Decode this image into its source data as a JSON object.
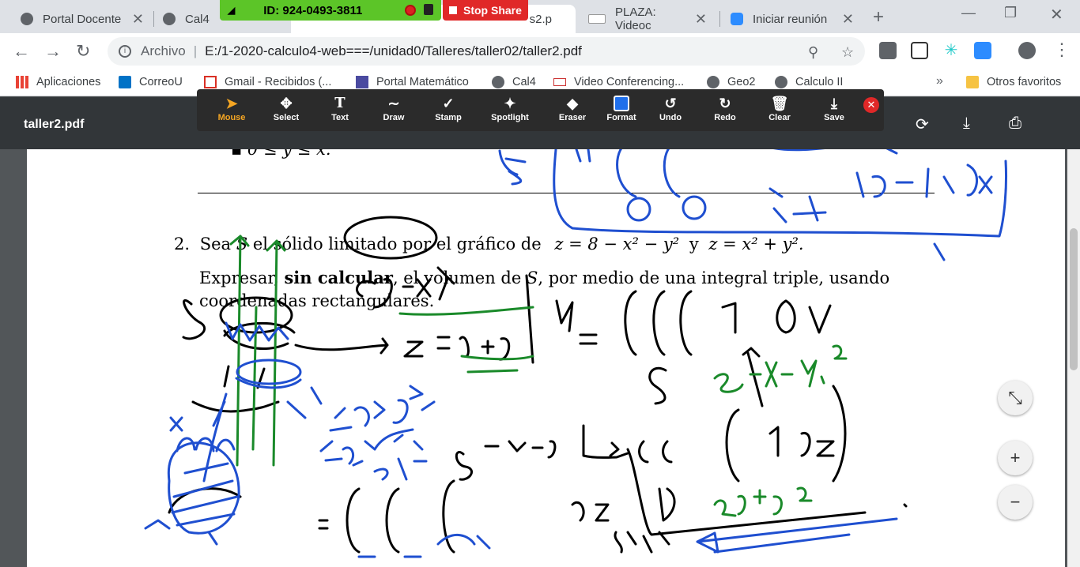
{
  "tabs": [
    {
      "label": "Portal Docente",
      "active": false
    },
    {
      "label": "Cal4",
      "active": false
    },
    {
      "label": "s2.p",
      "active": true
    },
    {
      "label": "PLAZA: Videoc",
      "active": false
    },
    {
      "label": "Iniciar reunión",
      "active": false
    }
  ],
  "zoom": {
    "meeting_id": "ID: 924-0493-3811",
    "stop_share_label": "Stop Share"
  },
  "address": {
    "scheme_label": "Archivo",
    "url": "E:/1-2020-calculo4-web===/unidad0/Talleres/taller02/taller2.pdf"
  },
  "bookmarks": [
    {
      "label": "Aplicaciones",
      "icon": "apps-grid-icon"
    },
    {
      "label": "CorreoU",
      "icon": "outlook-icon"
    },
    {
      "label": "Gmail - Recibidos (...",
      "icon": "gmail-icon"
    },
    {
      "label": "Portal Matemático",
      "icon": "pattern-icon"
    },
    {
      "label": "Cal4",
      "icon": "globe-icon"
    },
    {
      "label": "Video Conferencing...",
      "icon": "flag-icon"
    },
    {
      "label": "Geo2",
      "icon": "globe-icon"
    },
    {
      "label": "Calculo II",
      "icon": "globe-icon"
    }
  ],
  "other_bookmarks": "Otros favoritos",
  "pdf": {
    "title": "taller2.pdf",
    "header_fragment": "0 ≤ y ≤ x.",
    "problem_number": "2.",
    "line1_a": "Sea",
    "line1_S": "S",
    "line1_b": "el sólido limitado por el gráfico de",
    "line1_eq1": "z = 8 − x² − y²",
    "line1_y": "y",
    "line1_eq2": "z = x² + y².",
    "line2_a": "Expresar,",
    "line2_bold": "sin calcular",
    "line2_b": ", el volumen de",
    "line2_S": "S",
    "line2_c": ", por medio de una integral triple, usando",
    "line3": "coordenadas rectangulares."
  },
  "annotate_tools": [
    {
      "label": "Mouse",
      "icon": "cursor-icon",
      "selected": true
    },
    {
      "label": "Select",
      "icon": "move-icon",
      "selected": false
    },
    {
      "label": "Text",
      "icon": "text-icon",
      "selected": false
    },
    {
      "label": "Draw",
      "icon": "draw-icon",
      "selected": false
    },
    {
      "label": "Stamp",
      "icon": "check-icon",
      "selected": false
    },
    {
      "label": "Spotlight",
      "icon": "spotlight-icon",
      "selected": false
    },
    {
      "label": "Eraser",
      "icon": "eraser-icon",
      "selected": false
    },
    {
      "label": "Format",
      "icon": "format-icon",
      "selected": false
    },
    {
      "label": "Undo",
      "icon": "undo-icon",
      "selected": false
    },
    {
      "label": "Redo",
      "icon": "redo-icon",
      "selected": false
    },
    {
      "label": "Clear",
      "icon": "trash-icon",
      "selected": false
    },
    {
      "label": "Save",
      "icon": "save-icon",
      "selected": false
    }
  ],
  "colors": {
    "zoom_green": "#5cc528",
    "stop_red": "#e02828",
    "ink_black": "#000000",
    "ink_blue": "#1f4fd0",
    "ink_green": "#1a8a2a",
    "selected_tool": "#f5a623"
  }
}
